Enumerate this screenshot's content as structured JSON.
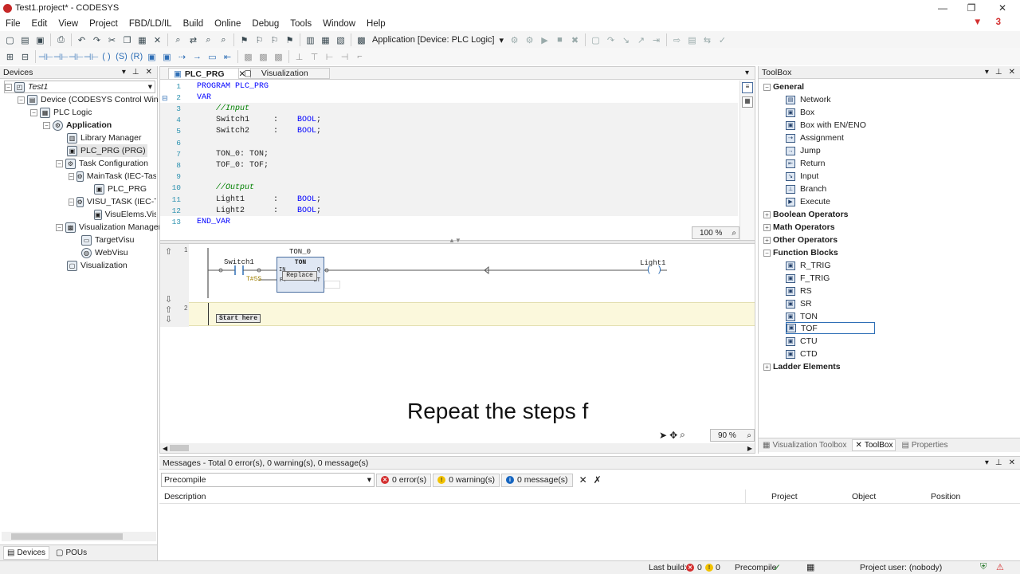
{
  "window": {
    "title": "Test1.project* - CODESYS",
    "minimize": "—",
    "restore": "❐",
    "close": "✕"
  },
  "menu": {
    "items": [
      "File",
      "Edit",
      "View",
      "Project",
      "FBD/LD/IL",
      "Build",
      "Online",
      "Debug",
      "Tools",
      "Window",
      "Help"
    ],
    "warning_count": "3"
  },
  "toolbar": {
    "active_application": "Application [Device: PLC Logic]"
  },
  "devices": {
    "title": "Devices",
    "tree": {
      "root": "Test1",
      "device": "Device (CODESYS Control Win V3)",
      "plc_logic": "PLC Logic",
      "application": "Application",
      "library_manager": "Library Manager",
      "plc_prg": "PLC_PRG (PRG)",
      "task_configuration": "Task Configuration",
      "main_task": "MainTask (IEC-Tasks)",
      "main_task_call": "PLC_PRG",
      "visu_task": "VISU_TASK (IEC-Tasks)",
      "visu_task_call": "VisuElems.Visu_",
      "visu_manager": "Visualization Manager",
      "target_visu": "TargetVisu",
      "web_visu": "WebVisu",
      "visualization": "Visualization"
    },
    "bottom_tabs": [
      "Devices",
      "POUs"
    ]
  },
  "editor": {
    "tabs": [
      "PLC_PRG",
      "Visualization"
    ],
    "declaration_lines": [
      {
        "n": "1",
        "t": "PROGRAM PLC_PRG"
      },
      {
        "n": "2",
        "t": "VAR"
      },
      {
        "n": "3",
        "t": "    //Input"
      },
      {
        "n": "4",
        "t": "    Switch1     :    BOOL;"
      },
      {
        "n": "5",
        "t": "    Switch2     :    BOOL;"
      },
      {
        "n": "6",
        "t": ""
      },
      {
        "n": "7",
        "t": "    TON_0: TON;"
      },
      {
        "n": "8",
        "t": "    TOF_0: TOF;"
      },
      {
        "n": "9",
        "t": ""
      },
      {
        "n": "10",
        "t": "    //Output"
      },
      {
        "n": "11",
        "t": "    Light1      :    BOOL;"
      },
      {
        "n": "12",
        "t": "    Light2      :    BOOL;"
      },
      {
        "n": "13",
        "t": "END_VAR"
      }
    ],
    "decl_zoom": "100 %",
    "ladder": {
      "network1_number": "1",
      "network2_number": "2",
      "contact_label": "Switch1",
      "fb_instance": "TON_0",
      "fb_type": "TON",
      "fb_pt_value": "T#5S",
      "fb_in_pin": "IN",
      "fb_q_pin": "Q",
      "fb_pt_pin": "PT",
      "fb_et_pin": "ET",
      "replace_tooltip": "Replace",
      "coil_label": "Light1",
      "start_here": "Start here",
      "zoom": "90 %"
    },
    "subtitle": "Repeat the steps f"
  },
  "toolbox": {
    "title": "ToolBox",
    "general": "General",
    "general_items": [
      "Network",
      "Box",
      "Box with EN/ENO",
      "Assignment",
      "Jump",
      "Return",
      "Input",
      "Branch",
      "Execute"
    ],
    "categories": [
      "Boolean Operators",
      "Math Operators",
      "Other Operators"
    ],
    "function_blocks": "Function Blocks",
    "fb_items": [
      "R_TRIG",
      "F_TRIG",
      "RS",
      "SR",
      "TON",
      "TOF",
      "CTU",
      "CTD"
    ],
    "selected_item": "TOF",
    "ladder": "Ladder Elements",
    "bottom_tabs": [
      "Visualization Toolbox",
      "ToolBox",
      "Properties"
    ]
  },
  "messages": {
    "title": "Messages - Total 0 error(s), 0 warning(s), 0 message(s)",
    "filter": "Precompile",
    "errors": "0 error(s)",
    "warnings": "0 warning(s)",
    "infos": "0 message(s)",
    "columns": [
      "Description",
      "Project",
      "Object",
      "Position"
    ]
  },
  "status": {
    "last_build": "Last build:",
    "errors": "0",
    "warnings": "0",
    "precompile": "Precompile",
    "user": "Project user: (nobody)"
  },
  "colors": {
    "accent": "#2f6fb6",
    "highlight": "#fbf8dc",
    "error": "#d32f2f"
  }
}
